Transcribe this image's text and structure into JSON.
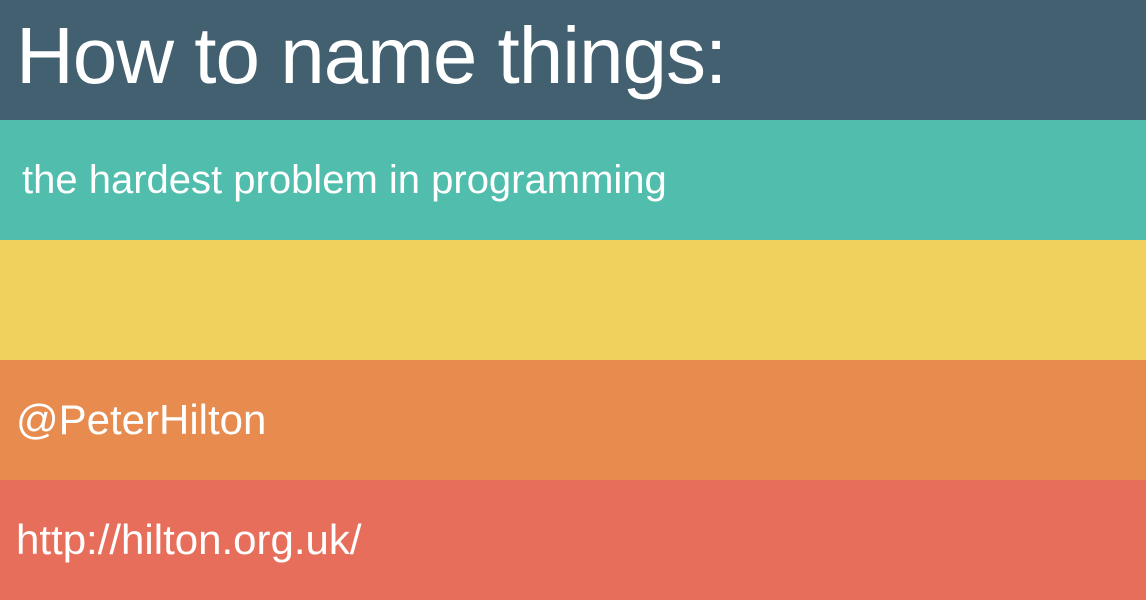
{
  "slide": {
    "title": "How to name things:",
    "subtitle": "the hardest problem in programming",
    "handle": "@PeterHilton",
    "url": "http://hilton.org.uk/"
  },
  "colors": {
    "band_1": "#42606f",
    "band_2": "#51bdad",
    "band_3": "#f1d15e",
    "band_4": "#e78b4e",
    "band_5": "#e66e5b",
    "text": "#ffffff"
  }
}
